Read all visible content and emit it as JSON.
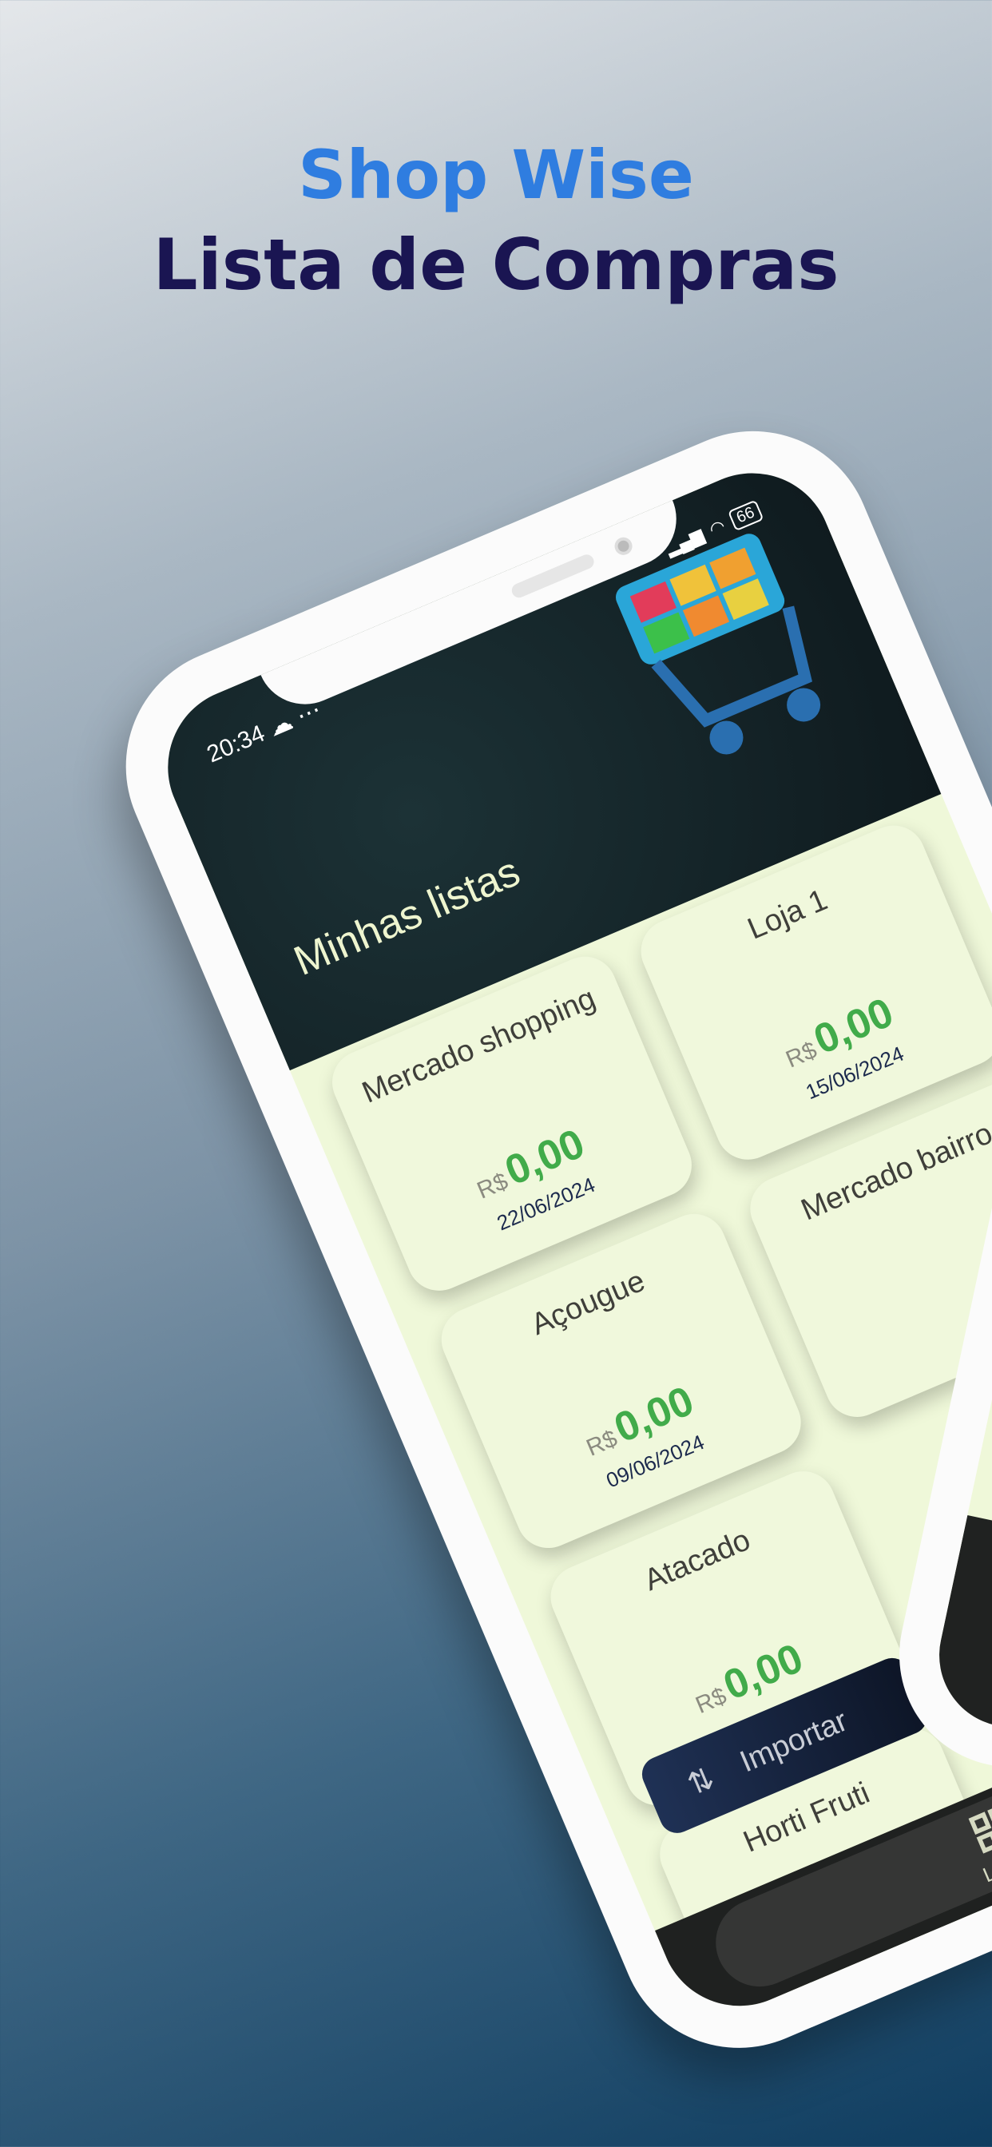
{
  "hero": {
    "app_name": "Shop Wise",
    "subtitle": "Lista de Compras"
  },
  "status": {
    "time": "20:34",
    "battery": "66"
  },
  "header": {
    "title": "Minhas listas"
  },
  "lists": [
    {
      "name": "Mercado shopping",
      "currency": "R$",
      "value": "0,00",
      "date": "22/06/2024"
    },
    {
      "name": "Loja 1",
      "currency": "R$",
      "value": "0,00",
      "date": "15/06/2024"
    },
    {
      "name": "Açougue",
      "currency": "R$",
      "value": "0,00",
      "date": "09/06/2024"
    },
    {
      "name": "Mercado bairro"
    },
    {
      "name": "Atacado",
      "currency": "R$",
      "value": "0,00"
    },
    {
      "name": "Horti Fruti"
    }
  ],
  "import_button": "Importar",
  "nav": {
    "lists_label": "Listas"
  },
  "colors": {
    "accent": "#2f7de0",
    "value_green": "#41ab4a",
    "navy": "#1a1552"
  }
}
